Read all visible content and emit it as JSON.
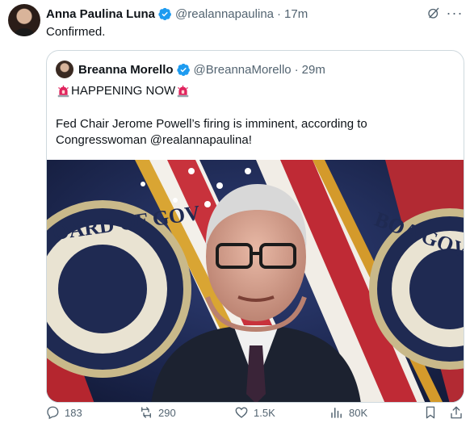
{
  "tweet": {
    "author_name": "Anna Paulina Luna",
    "author_handle": "@realannapaulina",
    "time": "17m",
    "text": "Confirmed.",
    "icons": {
      "avatar": "avatar",
      "verified": "verified-badge-icon",
      "grok": "grok-icon",
      "more": "more-icon"
    }
  },
  "quoted": {
    "author_name": "Breanna Morello",
    "author_handle": "@BreannaMorello",
    "time": "29m",
    "headline": "HAPPENING NOW",
    "text": "Fed Chair Jerome Powell’s firing is imminent, according to Congresswoman @realannapaulina!",
    "image_watermark_left": "OARD OF GOV",
    "image_watermark_right": "BOA GOVER"
  },
  "actions": {
    "replies": "183",
    "reposts": "290",
    "likes": "1.5K",
    "views": "80K"
  },
  "colors": {
    "accent": "#1d9bf0",
    "muted": "#536471",
    "border": "#cfd9de"
  }
}
